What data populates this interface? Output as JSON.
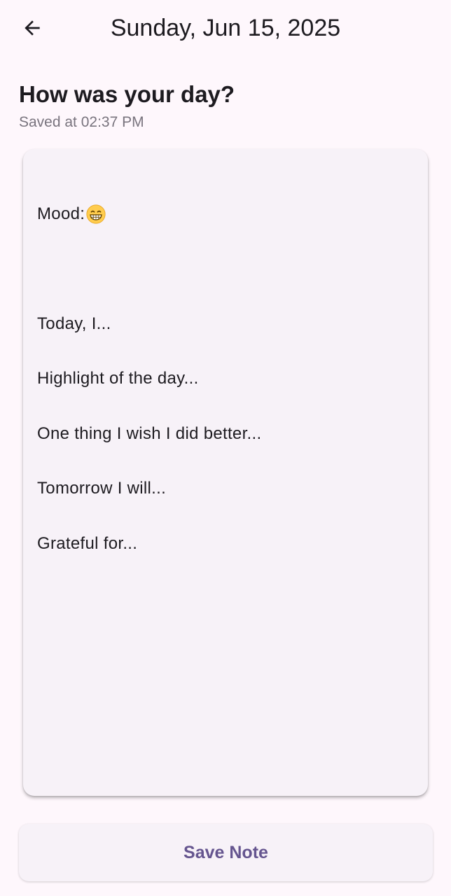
{
  "app_bar": {
    "back_icon": "arrow-left-icon",
    "title": "Sunday, Jun 15, 2025"
  },
  "header": {
    "heading": "How was your day?",
    "saved_at": "Saved at 02:37 PM"
  },
  "note": {
    "mood_label": "Mood:",
    "mood_icon": "grinning-face-icon",
    "lines": [
      "Today, I...",
      "Highlight of the day...",
      "One thing I wish I did better...",
      "Tomorrow I will...",
      "Grateful for..."
    ]
  },
  "actions": {
    "save_label": "Save Note"
  },
  "colors": {
    "background": "#FEF7FC",
    "card": "#F7F2F8",
    "primary_text": "#1D1B20",
    "secondary_text": "#79747E",
    "accent": "#65558F"
  }
}
